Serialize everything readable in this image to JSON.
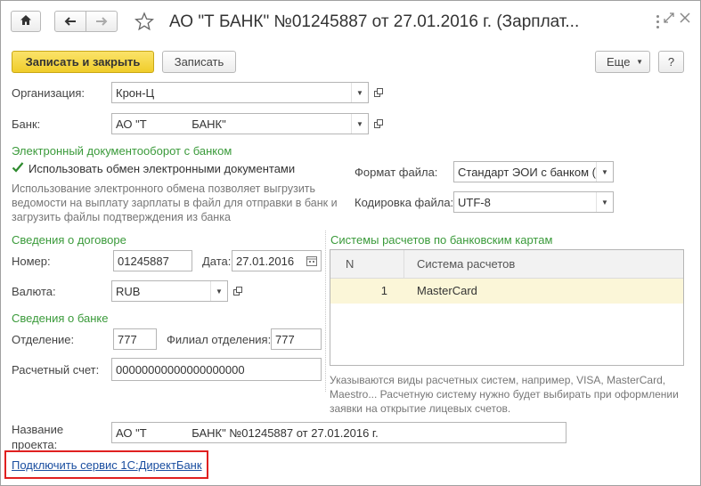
{
  "toolbar": {
    "home_icon": "home-icon",
    "back_icon": "arrow-left-icon",
    "forward_icon": "arrow-right-icon",
    "star_icon": "star-icon",
    "title": "АО \"Т              БАНК\" №01245887 от 27.01.2016 г. (Зарплат...",
    "more_icon": "kebab-icon",
    "maximize_icon": "maximize-icon",
    "close_icon": "close-icon"
  },
  "actions": {
    "save_close": "Записать и закрыть",
    "save": "Записать",
    "more": "Еще",
    "help": "?"
  },
  "form": {
    "org_label": "Организация:",
    "org_value": "Крон-Ц",
    "bank_label": "Банк:",
    "bank_value": "АО \"Т              БАНК\"",
    "edo_group": "Электронный документооборот с банком",
    "edo_checkbox_label": "Использовать обмен электронными документами",
    "edo_checked": true,
    "edo_note": "Использование электронного обмена позволяет выгрузить ведомости на выплату зарплаты в файл для отправки в банк и загрузить файлы подтверждения из банка",
    "format_label": "Формат файла:",
    "format_value": "Стандарт ЭОИ с банком (",
    "encoding_label": "Кодировка файла:",
    "encoding_value": "UTF-8",
    "contract_group": "Сведения о договоре",
    "number_label": "Номер:",
    "number_value": "01245887",
    "date_label": "Дата:",
    "date_value": "27.01.2016",
    "currency_label": "Валюта:",
    "currency_value": "RUB",
    "bank_info_group": "Сведения о банке",
    "branch_label": "Отделение:",
    "branch_value": "777",
    "subbranch_label": "Филиал отделения:",
    "subbranch_value": "777",
    "account_label": "Расчетный счет:",
    "account_value": "00000000000000000000",
    "cards_group": "Системы расчетов по банковским картам",
    "cards_table": {
      "headers": [
        "N",
        "Система расчетов"
      ],
      "rows": [
        {
          "n": "1",
          "system": "MasterCard"
        }
      ]
    },
    "cards_note": "Указываются виды расчетных систем, например, VISA, MasterCard, Maestro... Расчетную систему нужно будет выбирать при оформлении заявки на открытие лицевых счетов.",
    "project_label_1": "Название",
    "project_label_2": "проекта:",
    "project_value": "АО \"Т              БАНК\" №01245887 от 27.01.2016 г.",
    "directbank_link": "Подключить сервис 1С:ДиректБанк"
  },
  "colors": {
    "primary_button": "#f5d53b",
    "group_heading": "#3a9a3a",
    "highlight_row": "#fbf6d8",
    "callout_border": "#e02020",
    "link": "#1a4ea0"
  }
}
